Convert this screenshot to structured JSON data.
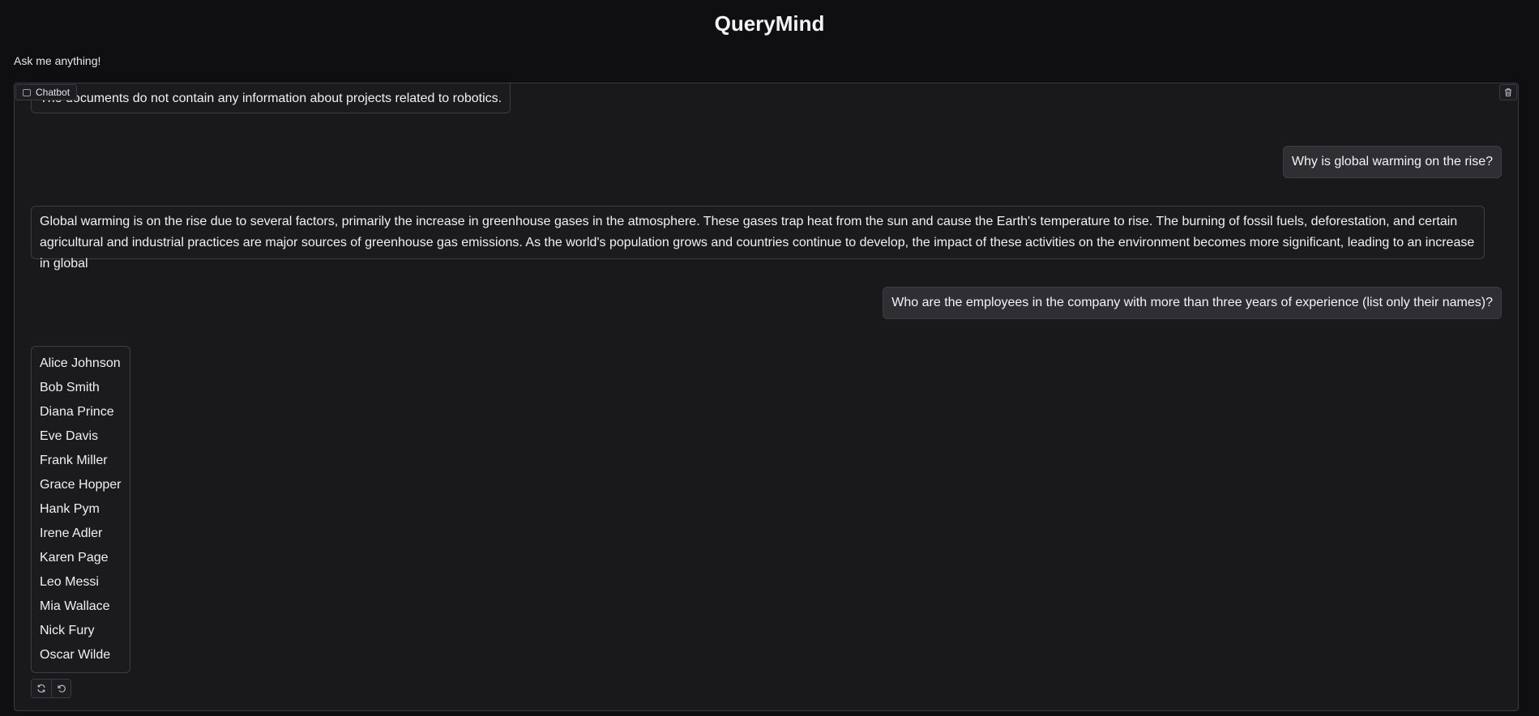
{
  "header": {
    "title": "QueryMind",
    "subtitle": "Ask me anything!"
  },
  "chatbot": {
    "label": "Chatbot",
    "label_icon": "chat-icon",
    "clear_icon": "trash-icon",
    "messages": [
      {
        "role": "bot",
        "text": "The documents do not contain any information about projects related to robotics."
      },
      {
        "role": "user",
        "text": "Why is global warming on the rise?"
      },
      {
        "role": "bot",
        "text": "Global warming is on the rise due to several factors, primarily the increase in greenhouse gases in the atmosphere. These gases trap heat from the sun and cause the Earth's temperature to rise. The burning of fossil fuels, deforestation, and certain agricultural and industrial practices are major sources of greenhouse gas emissions. As the world's population grows and countries continue to develop, the impact of these activities on the environment becomes more significant, leading to an increase in global"
      },
      {
        "role": "user",
        "text": "Who are the employees in the company with more than three years of experience (list only their names)?"
      },
      {
        "role": "bot",
        "names": [
          "Alice Johnson",
          "Bob Smith",
          "Diana Prince",
          "Eve Davis",
          "Frank Miller",
          "Grace Hopper",
          "Hank Pym",
          "Irene Adler",
          "Karen Page",
          "Leo Messi",
          "Mia Wallace",
          "Nick Fury",
          "Oscar Wilde"
        ]
      }
    ],
    "actions": [
      {
        "icon": "retry-icon"
      },
      {
        "icon": "undo-icon"
      }
    ]
  }
}
